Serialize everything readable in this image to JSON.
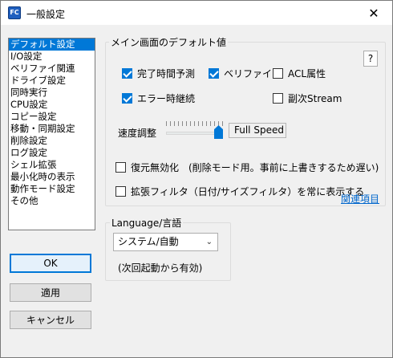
{
  "window": {
    "title": "一般設定",
    "app_icon": "FC",
    "close_glyph": "✕"
  },
  "sidebar": {
    "items": [
      {
        "label": "デフォルト設定",
        "selected": true
      },
      {
        "label": "I/O設定"
      },
      {
        "label": "ベリファイ関連"
      },
      {
        "label": "ドライブ設定"
      },
      {
        "label": "同時実行"
      },
      {
        "label": "CPU設定"
      },
      {
        "label": "コピー設定"
      },
      {
        "label": "移動・同期設定"
      },
      {
        "label": "削除設定"
      },
      {
        "label": "ログ設定"
      },
      {
        "label": "シェル拡張"
      },
      {
        "label": "最小化時の表示"
      },
      {
        "label": "動作モード設定"
      },
      {
        "label": "その他"
      }
    ]
  },
  "buttons": {
    "ok": "OK",
    "apply": "適用",
    "cancel": "キャンセル",
    "help": "?"
  },
  "main_group": {
    "title": "メイン画面のデフォルト値",
    "checkboxes": {
      "estimate": {
        "label": "完了時間予測",
        "checked": true
      },
      "verify": {
        "label": "ベリファイ",
        "checked": true
      },
      "acl": {
        "label": "ACL属性",
        "checked": false
      },
      "continue_on_error": {
        "label": "エラー時継続",
        "checked": true
      },
      "stream": {
        "label": "副次Stream",
        "checked": false
      },
      "restore_disable": {
        "label": "復元無効化　(削除モード用。事前に上書きするため遅い)",
        "checked": false
      },
      "ext_filter": {
        "label": "拡張フィルタ（日付/サイズフィルタ）を常に表示する",
        "checked": false
      }
    },
    "speed_label": "速度調整",
    "speed_value": "Full Speed",
    "speed_level": 1.0,
    "related_link": "関連項目"
  },
  "language_group": {
    "title": "Language/言語",
    "selected": "システム/自動",
    "note": "(次回起動から有効)"
  }
}
